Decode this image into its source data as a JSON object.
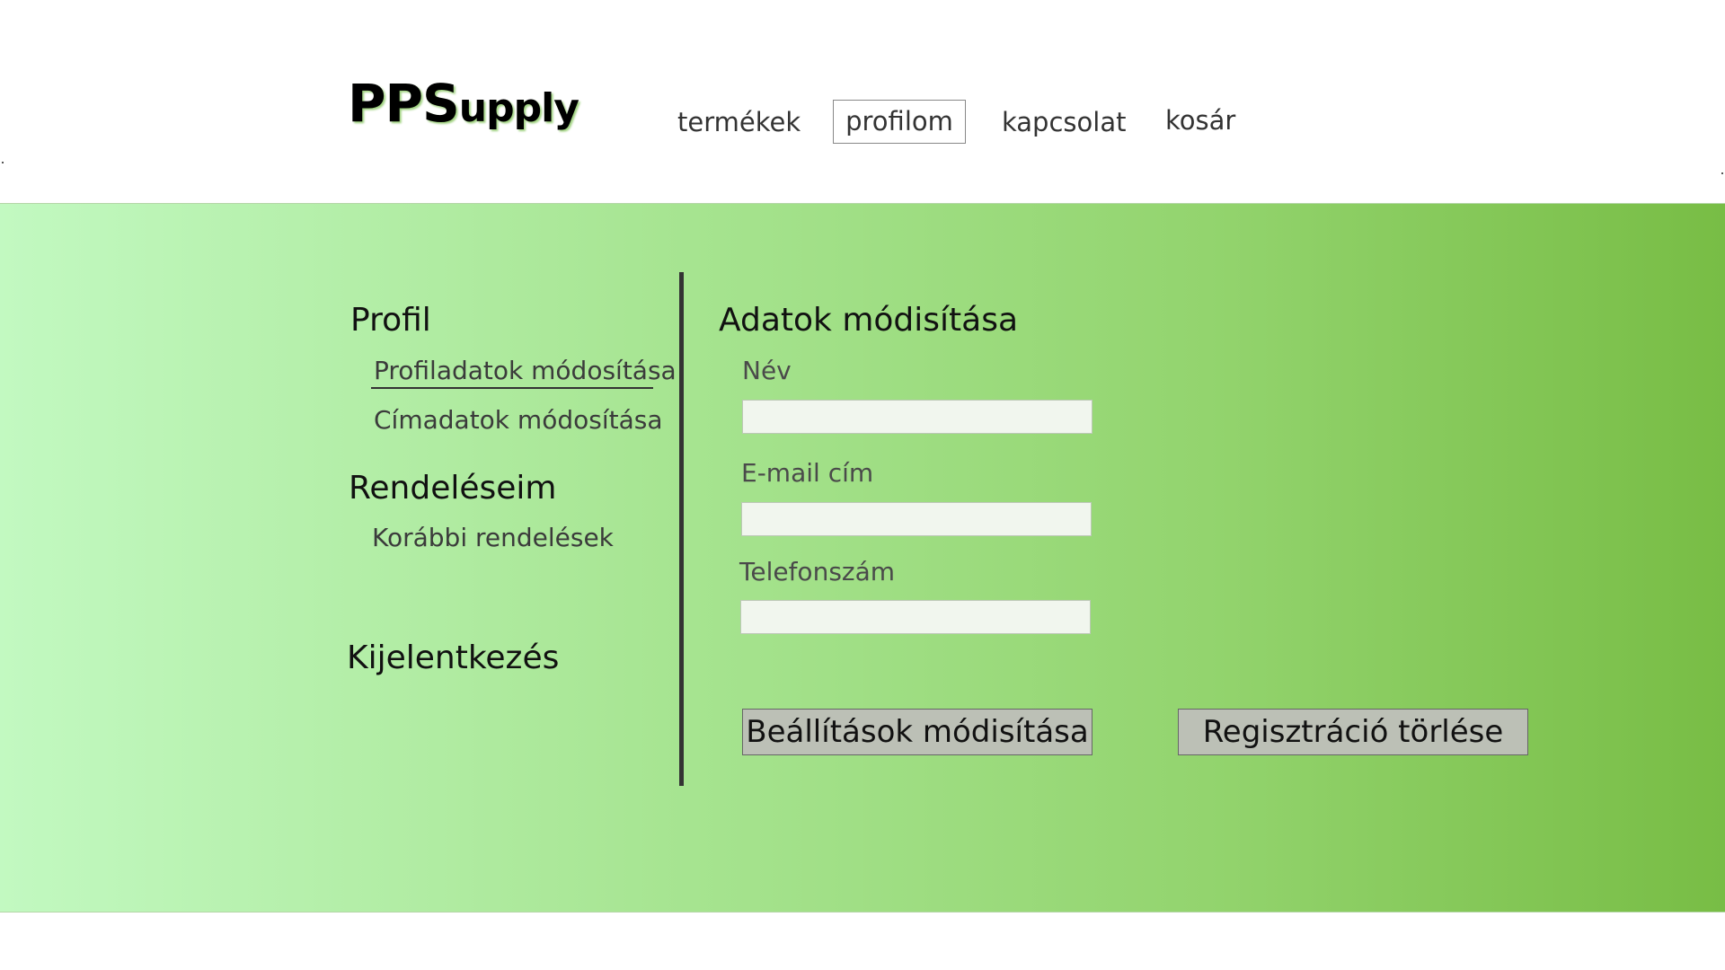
{
  "brand": {
    "logo_big": "PPS",
    "logo_small": "upply"
  },
  "nav": {
    "termekek": "termékek",
    "profilom": "profilom",
    "kapcsolat": "kapcsolat",
    "kosar": "kosár",
    "active": "profilom"
  },
  "sidebar": {
    "profil_heading": "Profil",
    "profiladatok": "Profiladatok módosítása",
    "cimadatok": "Címadatok módosítása",
    "rendeleseim_heading": "Rendeléseim",
    "korabbi": "Korábbi rendelések",
    "kijelentkezes": "Kijelentkezés"
  },
  "form": {
    "title": "Adatok módisítása",
    "name_label": "Név",
    "name_value": "",
    "email_label": "E-mail cím",
    "email_value": "",
    "phone_label": "Telefonszám",
    "phone_value": "",
    "save_button": "Beállítások módisítása",
    "delete_button": "Regisztráció törlése"
  },
  "colors": {
    "gradient_start": "#c2f9c1",
    "gradient_end": "#78bd45",
    "button_bg": "#bcc0b6",
    "input_bg": "#f1f6ee"
  }
}
